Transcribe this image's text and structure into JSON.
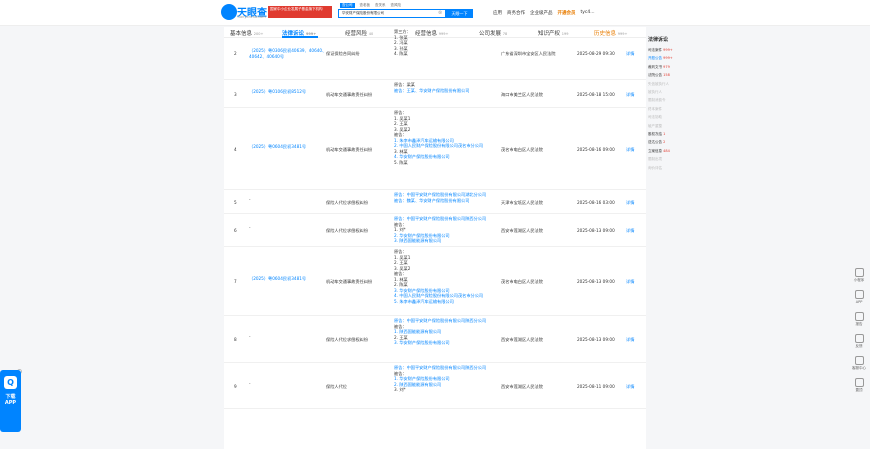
{
  "topbar": {
    "logo_title": "天眼查",
    "logo_sub": "Tianyancha.com",
    "promo": "国家中小企业发展子基金旗下机构",
    "search_tabs": [
      "查公司",
      "查老板",
      "查关系",
      "查风险"
    ],
    "search_value": "华安财产保险股份有限公司",
    "search_button": "天眼一下",
    "nav": [
      "应用",
      "商务合作",
      "企业级产品",
      "开通会员",
      "tyc4..."
    ]
  },
  "tabs": [
    {
      "label": "基本信息",
      "count": "200+"
    },
    {
      "label": "法律诉讼",
      "count": "999+"
    },
    {
      "label": "经营风险",
      "count": "40"
    },
    {
      "label": "经营信息",
      "count": "999+"
    },
    {
      "label": "公司发展",
      "count": "78"
    },
    {
      "label": "知识产权",
      "count": "199"
    },
    {
      "label": "历史信息",
      "count": "999+"
    }
  ],
  "rows": [
    {
      "no": "2",
      "case_no": "（2025）粤0306民初40639、40640、40642、40640号",
      "cause": "保证保险合同纠纷",
      "parties": [
        "第三方：",
        "1. 张某",
        "2. 冯某",
        "3. 孙某",
        "4. 陈某"
      ],
      "court": "广东省深圳市宝安区人民法院",
      "date": "2025-08-29 09:30",
      "action": "详情"
    },
    {
      "no": "3",
      "case_no": "（2025）粤0106民初8512号",
      "cause": "机动车交通事故责任纠纷",
      "parties": [
        "原告：梁某",
        "被告：王某、华安财产保险股份有限公司"
      ],
      "court": "海口市美兰区人民法院",
      "date": "2025-08-18 15:00",
      "action": "详情"
    },
    {
      "no": "4",
      "case_no": "（2025）粤0604民初3481号",
      "cause": "机动车交通事故责任纠纷",
      "parties": [
        "原告：",
        "1. 吴某1",
        "2. 王某",
        "3. 吴某2",
        "被告：",
        "1. 朱李市鑫泽汽车运输有限公司",
        "2. 中国人民财产保险股份有限公司茂名市分公司",
        "3. 林某",
        "4. 华安财产保险股份有限公司",
        "5. 陈某"
      ],
      "court": "茂名市电白区人民法院",
      "date": "2025-08-16 09:00",
      "action": "详情"
    },
    {
      "no": "5",
      "case_no": "-",
      "cause": "保险人代位求偿权纠纷",
      "parties": [
        "原告：中国平安财产保险股份有限公司湖北分公司",
        "被告：魏某、华安财产保险股份有限公司"
      ],
      "court": "天津市宝坻区人民法院",
      "date": "2025-08-16 03:00",
      "action": "详情"
    },
    {
      "no": "6",
      "case_no": "-",
      "cause": "保险人代位求偿权纠纷",
      "parties": [
        "原告：中国平安财产保险股份有限公司陕西分公司",
        "被告：",
        "1. 刘*",
        "2. 华安财产保险股份有限公司",
        "3. 陕西国能能源有限公司"
      ],
      "court": "西安市莲湖区人民法院",
      "date": "2025-08-13 09:00",
      "action": "详情"
    },
    {
      "no": "7",
      "case_no": "（2025）粤0604民初3481号",
      "cause": "机动车交通事故责任纠纷",
      "parties": [
        "原告：",
        "1. 吴某1",
        "2. 王某",
        "3. 吴某2",
        "被告：",
        "1. 林某",
        "2. 陈某",
        "3. 华安财产保险股份有限公司",
        "4. 中国人民财产保险股份有限公司茂名市分公司",
        "5. 朱李市鑫泽汽车运输有限公司"
      ],
      "court": "茂名市电白区人民法院",
      "date": "2025-08-13 09:00",
      "action": "详情"
    },
    {
      "no": "8",
      "case_no": "-",
      "cause": "保险人代位求偿权纠纷",
      "parties": [
        "原告：中国平安财产保险股份有限公司陕西分公司",
        "被告：",
        "1. 陕西国能能源有限公司",
        "2. 王某",
        "3. 华安财产保险股份有限公司"
      ],
      "court": "西安市莲湖区人民法院",
      "date": "2025-08-13 09:00",
      "action": "详情"
    },
    {
      "no": "9",
      "case_no": "-",
      "cause": "保险人代位",
      "parties": [
        "原告：中国平安财产保险股份有限公司陕西分公司",
        "被告：",
        "1. 华安财产保险股份有限公司",
        "2. 陕西国能能源有限公司",
        "3. 刘*"
      ],
      "court": "西安市莲湖区人民法院",
      "date": "2025-08-11 09:00",
      "action": "详情"
    }
  ],
  "sidebar": {
    "title": "法律诉讼",
    "items": [
      {
        "label": "司法案件",
        "count": "999+"
      },
      {
        "label": "开庭公告",
        "count": "999+"
      },
      {
        "label": "裁判文书",
        "count": "979"
      },
      {
        "label": "法院公告",
        "count": "158"
      },
      {
        "label": "失信被执行人",
        "count": ""
      },
      {
        "label": "被执行人",
        "count": ""
      },
      {
        "label": "限制消费令",
        "count": ""
      },
      {
        "label": "终本案件",
        "count": ""
      },
      {
        "label": "司法协助",
        "count": ""
      },
      {
        "label": "破产重整",
        "count": ""
      },
      {
        "label": "股权冻结",
        "count": "1"
      },
      {
        "label": "送达公告",
        "count": "2"
      },
      {
        "label": "立案信息",
        "count": "484"
      },
      {
        "label": "限制出境",
        "count": ""
      },
      {
        "label": "询价评估",
        "count": ""
      }
    ]
  },
  "right_tools": [
    "小程序",
    "APP",
    "报告",
    "反馈",
    "客服中心",
    "置顶"
  ],
  "app_promo": {
    "icon": "Q",
    "label": "下载APP"
  }
}
